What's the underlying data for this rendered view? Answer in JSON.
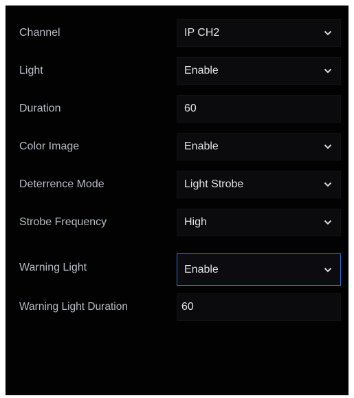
{
  "settings": {
    "rows": [
      {
        "label": "Channel",
        "value": "IP CH2",
        "control": "dropdown",
        "icon": "chevron-down-icon"
      },
      {
        "label": "Light",
        "value": "Enable",
        "control": "dropdown",
        "icon": "chevron-down-icon"
      },
      {
        "label": "Duration",
        "value": "60",
        "control": "text"
      },
      {
        "label": "Color Image",
        "value": "Enable",
        "control": "dropdown",
        "icon": "chevron-down-icon"
      },
      {
        "label": "Deterrence Mode",
        "value": "Light Strobe",
        "control": "dropdown",
        "icon": "chevron-down-icon"
      },
      {
        "label": "Strobe Frequency",
        "value": "High",
        "control": "dropdown",
        "icon": "chevron-down-icon"
      },
      {
        "label": "Warning Light",
        "value": "Enable",
        "control": "dropdown",
        "icon": "chevron-down-icon",
        "focused": true
      },
      {
        "label": "Warning Light Duration",
        "value": "60",
        "control": "text"
      }
    ]
  },
  "colors": {
    "background": "#020203",
    "label_text": "#b9bcc3",
    "value_text": "#e3e4e8",
    "field_bg": "#0b0b0d",
    "focus_border": "#2f6fd0"
  }
}
